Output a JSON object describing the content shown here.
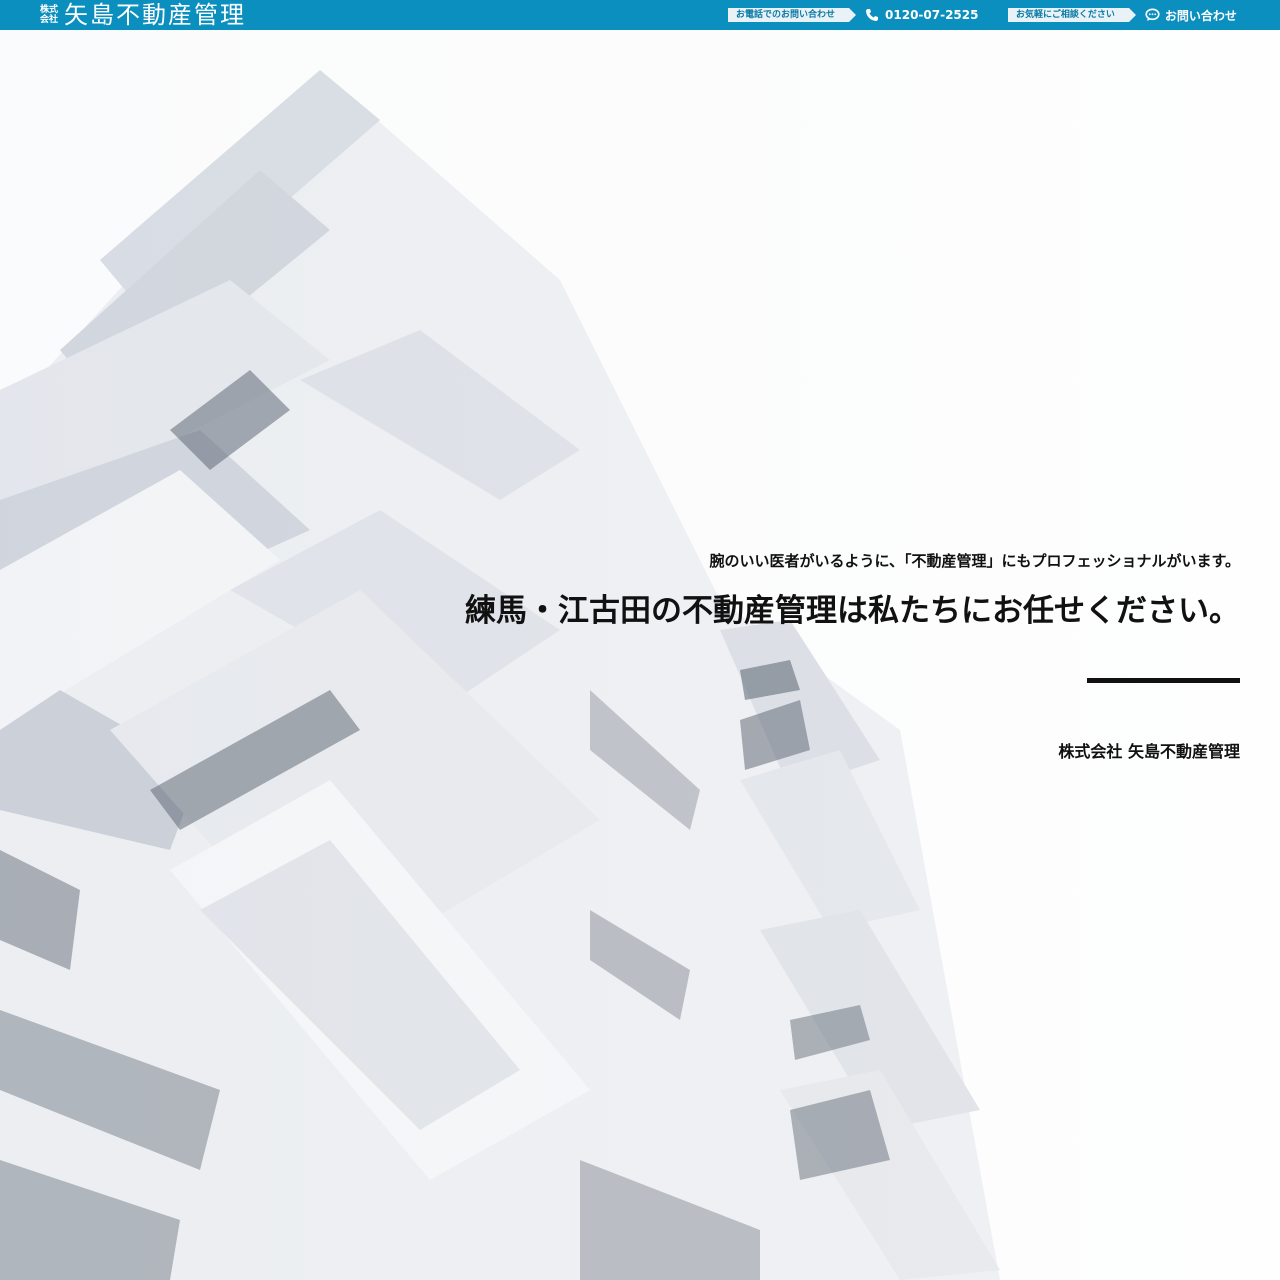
{
  "header": {
    "logo_prefix_top": "株式",
    "logo_prefix_bottom": "会社",
    "logo_name": "矢島不動産管理",
    "phone_tag": "お電話でのお問い合わせ",
    "phone_number": "0120-07-2525",
    "consult_tag": "お気軽にご相談ください",
    "contact_label": "お問い合わせ"
  },
  "hero": {
    "subcopy": "腕のいい医者がいるように、「不動産管理」にもプロフェッショナルがいます。",
    "maincopy": "練馬・江古田の不動産管理は私たちにお任せください。",
    "company": "株式会社 矢島不動産管理"
  },
  "colors": {
    "brand": "#0a8fbf",
    "text": "#111111"
  },
  "icons": {
    "phone": "phone-icon",
    "chat": "chat-bubble-icon"
  }
}
